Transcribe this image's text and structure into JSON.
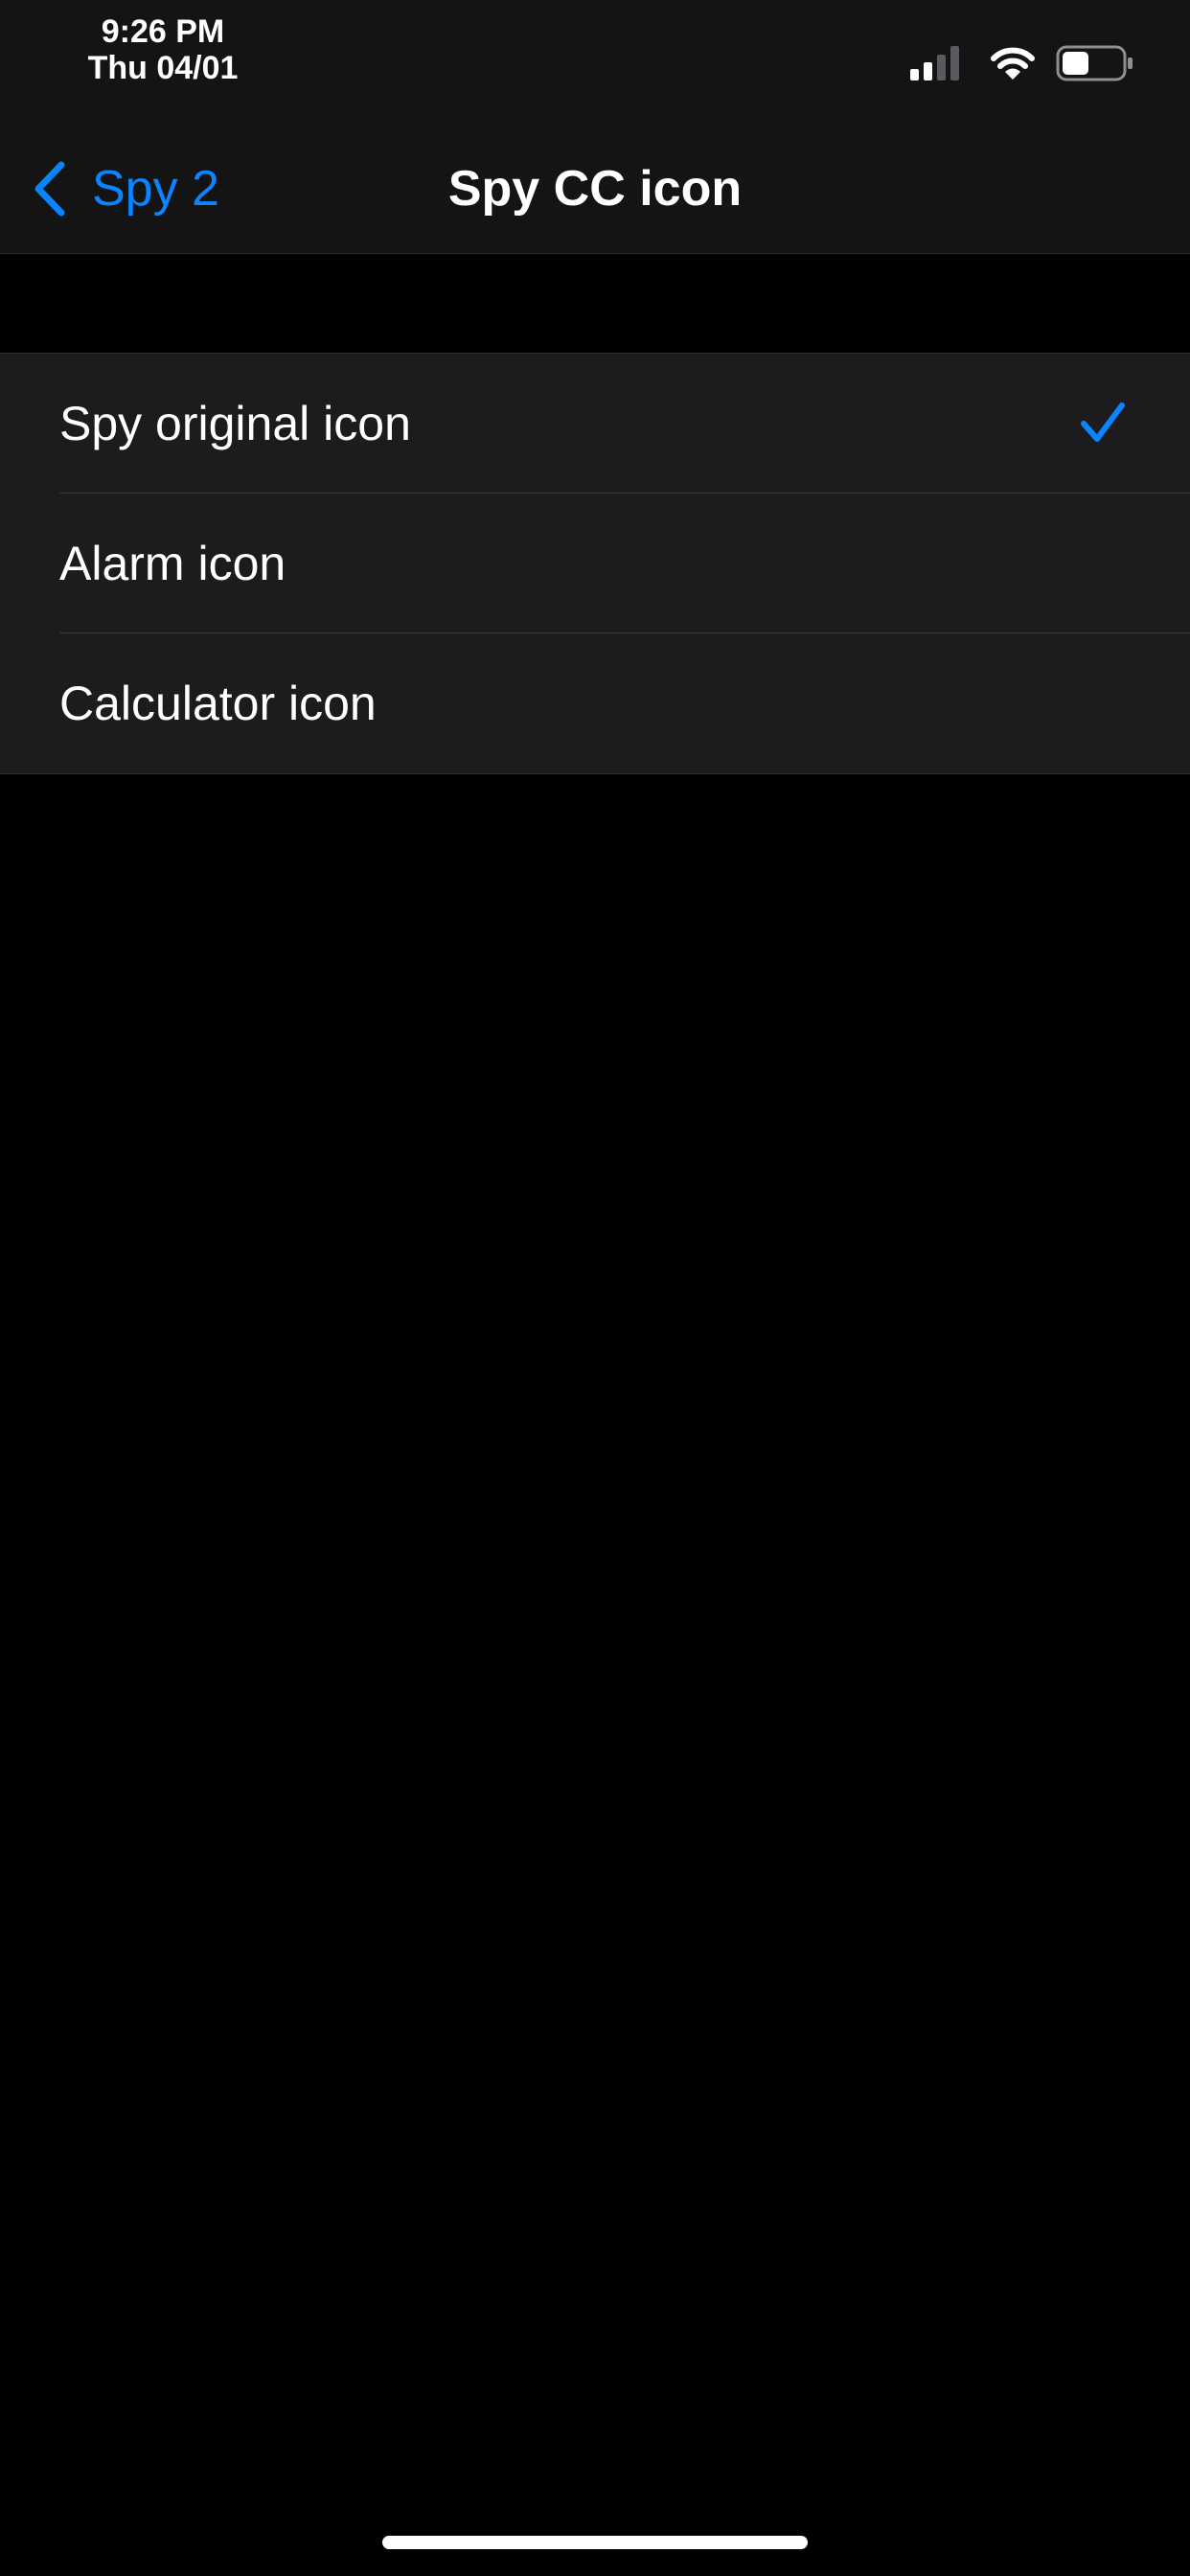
{
  "status_bar": {
    "time": "9:26 PM",
    "date": "Thu 04/01",
    "icons": [
      "signal-icon",
      "wifi-icon",
      "battery-icon"
    ],
    "battery_level": 0.45
  },
  "nav": {
    "back_label": "Spy 2",
    "title": "Spy CC icon"
  },
  "options": [
    {
      "label": "Spy original icon",
      "selected": true
    },
    {
      "label": "Alarm icon",
      "selected": false
    },
    {
      "label": "Calculator icon",
      "selected": false
    }
  ],
  "colors": {
    "accent": "#0a84ff",
    "background": "#000000",
    "header": "#141414",
    "row": "#1c1c1e"
  }
}
